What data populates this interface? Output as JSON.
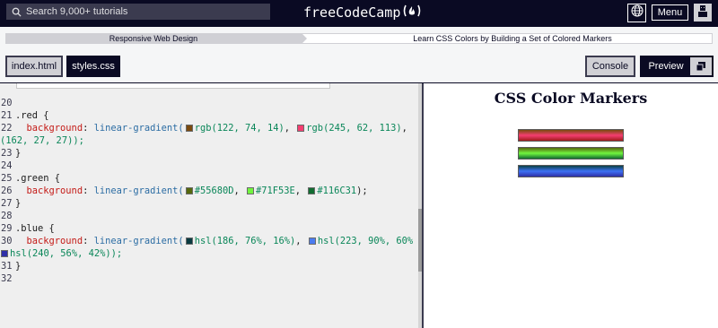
{
  "topnav": {
    "search_placeholder": "Search 9,000+ tutorials",
    "logo_text": "freeCodeCamp",
    "menu_label": "Menu"
  },
  "breadcrumb": {
    "superblock": "Responsive Web Design",
    "challenge": "Learn CSS Colors by Building a Set of Colored Markers"
  },
  "tabs": {
    "index": "index.html",
    "styles": "styles.css",
    "console": "Console",
    "preview": "Preview"
  },
  "editor": {
    "lines": {
      "l20": "20",
      "l21": "21",
      "l21_sel": ".red",
      "l21_brace": " {",
      "l22": "22",
      "l22_prop": "background",
      "l22_colon": ": ",
      "l22_fn": "linear-gradient(",
      "l22_c1": "rgb(122, 74, 14)",
      "l22_sep1": ", ",
      "l22_c2": "rgb(245, 62, 113)",
      "l22_sep2": ",",
      "l22w": "(162, 27, 27));",
      "l23": "23",
      "l23_text": "}",
      "l24": "24",
      "l25": "25",
      "l25_sel": ".green",
      "l25_brace": " {",
      "l26": "26",
      "l26_prop": "background",
      "l26_colon": ": ",
      "l26_fn": "linear-gradient(",
      "l26_c1": "#55680D",
      "l26_sep1": ", ",
      "l26_c2": "#71F53E",
      "l26_sep2": ", ",
      "l26_c3": "#116C31",
      "l26_end": ");",
      "l27": "27",
      "l27_text": "}",
      "l28": "28",
      "l29": "29",
      "l29_sel": ".blue",
      "l29_brace": " {",
      "l30": "30",
      "l30_prop": "background",
      "l30_colon": ": ",
      "l30_fn": "linear-gradient(",
      "l30_c1": "hsl(186, 76%, 16%)",
      "l30_sep1": ", ",
      "l30_c2": "hsl(223, 90%, 60%",
      "l30w": "hsl(240, 56%, 42%));",
      "l31": "31",
      "l31_text": "}",
      "l32": "32"
    },
    "swatches": {
      "red1": "#7a4a0e",
      "red2": "#f53e71",
      "green1": "#55680D",
      "green2": "#71F53E",
      "green3": "#116C31",
      "blue1": "#0a3a40",
      "blue2": "#4b7cf0",
      "blue3": "#2f2fa8"
    }
  },
  "preview": {
    "title": "CSS Color Markers",
    "markers": [
      "red",
      "green",
      "blue"
    ]
  },
  "colors": {
    "nav_bg": "#0a0a23",
    "accent_gray": "#d0d0d5",
    "editor_bg": "#efefef"
  }
}
